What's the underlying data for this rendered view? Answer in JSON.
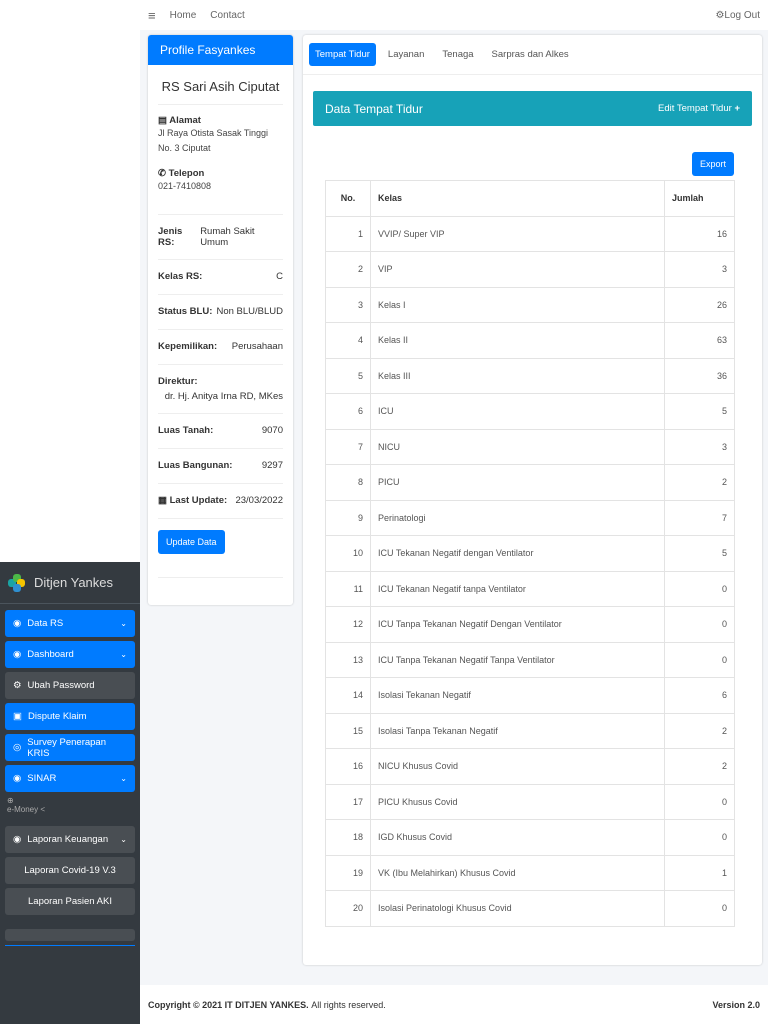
{
  "topnav": {
    "home": "Home",
    "contact": "Contact",
    "logout": "Log Out"
  },
  "sidebar": {
    "brand": "Ditjen Yankes",
    "items": [
      {
        "label": "Data RS"
      },
      {
        "label": "Dashboard"
      },
      {
        "label": "Ubah Password"
      },
      {
        "label": "Dispute Klaim"
      },
      {
        "label": "Survey Penerapan KRIS"
      },
      {
        "label": "SINAR"
      }
    ],
    "emoney": "e-Money <",
    "laporan": "Laporan Keuangan",
    "sub": [
      "Laporan Covid-19 V.3",
      "Laporan Pasien AKI"
    ]
  },
  "profile": {
    "header": "Profile Fasyankes",
    "name": "RS Sari Asih Ciputat",
    "alamat_label": "Alamat",
    "alamat": "Jl Raya Otista Sasak Tinggi No. 3 Ciputat",
    "telepon_label": "Telepon",
    "telepon": "021-7410808",
    "fields": [
      {
        "label": "Jenis RS:",
        "value": "Rumah Sakit Umum"
      },
      {
        "label": "Kelas RS:",
        "value": "C"
      },
      {
        "label": "Status BLU:",
        "value": "Non BLU/BLUD"
      },
      {
        "label": "Kepemilikan:",
        "value": "Perusahaan"
      },
      {
        "label": "Direktur:",
        "value": "dr. Hj. Anitya Irna RD, MKes"
      },
      {
        "label": "Luas Tanah:",
        "value": "9070"
      },
      {
        "label": "Luas Bangunan:",
        "value": "9297"
      },
      {
        "label": "Last Update:",
        "value": "23/03/2022"
      }
    ],
    "update": "Update Data"
  },
  "main": {
    "tabs": [
      "Tempat Tidur",
      "Layanan",
      "Tenaga",
      "Sarpras dan Alkes"
    ],
    "title": "Data Tempat Tidur",
    "edit": "Edit Tempat Tidur",
    "export": "Export",
    "columns": [
      "No.",
      "Kelas",
      "Jumlah"
    ],
    "rows": [
      [
        "1",
        "VVIP/ Super VIP",
        "16"
      ],
      [
        "2",
        "VIP",
        "3"
      ],
      [
        "3",
        "Kelas I",
        "26"
      ],
      [
        "4",
        "Kelas II",
        "63"
      ],
      [
        "5",
        "Kelas III",
        "36"
      ],
      [
        "6",
        "ICU",
        "5"
      ],
      [
        "7",
        "NICU",
        "3"
      ],
      [
        "8",
        "PICU",
        "2"
      ],
      [
        "9",
        "Perinatologi",
        "7"
      ],
      [
        "10",
        "ICU Tekanan Negatif dengan Ventilator",
        "5"
      ],
      [
        "11",
        "ICU Tekanan Negatif tanpa Ventilator",
        "0"
      ],
      [
        "12",
        "ICU Tanpa Tekanan Negatif Dengan Ventilator",
        "0"
      ],
      [
        "13",
        "ICU Tanpa Tekanan Negatif Tanpa Ventilator",
        "0"
      ],
      [
        "14",
        "Isolasi Tekanan Negatif",
        "6"
      ],
      [
        "15",
        "Isolasi Tanpa Tekanan Negatif",
        "2"
      ],
      [
        "16",
        "NICU Khusus Covid",
        "2"
      ],
      [
        "17",
        "PICU Khusus Covid",
        "0"
      ],
      [
        "18",
        "IGD Khusus Covid",
        "0"
      ],
      [
        "19",
        "VK (Ibu Melahirkan) Khusus Covid",
        "1"
      ],
      [
        "20",
        "Isolasi Perinatologi Khusus Covid",
        "0"
      ]
    ]
  },
  "footer": {
    "copyright": "Copyright © 2021 IT DITJEN YANKES.",
    "rights": "All rights reserved.",
    "version": "Version 2.0"
  }
}
